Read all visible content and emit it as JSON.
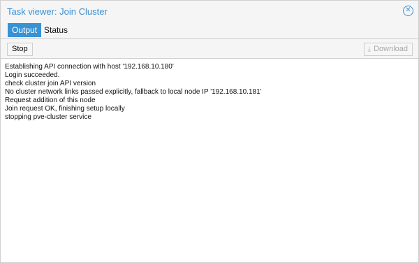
{
  "window": {
    "title": "Task viewer: Join Cluster",
    "close_icon": "close-circle-icon"
  },
  "tabs": [
    {
      "label": "Output",
      "active": true
    },
    {
      "label": "Status",
      "active": false
    }
  ],
  "toolbar": {
    "stop_label": "Stop",
    "download_label": "Download",
    "download_icon": "download-icon"
  },
  "log_lines": [
    "Establishing API connection with host '192.168.10.180'",
    "Login succeeded.",
    "check cluster join API version",
    "No cluster network links passed explicitly, fallback to local node IP '192.168.10.181'",
    "Request addition of this node",
    "Join request OK, finishing setup locally",
    "stopping pve-cluster service"
  ],
  "colors": {
    "accent": "#3892d4",
    "title": "#3a8fd4",
    "disabled": "#a8a8a8"
  }
}
